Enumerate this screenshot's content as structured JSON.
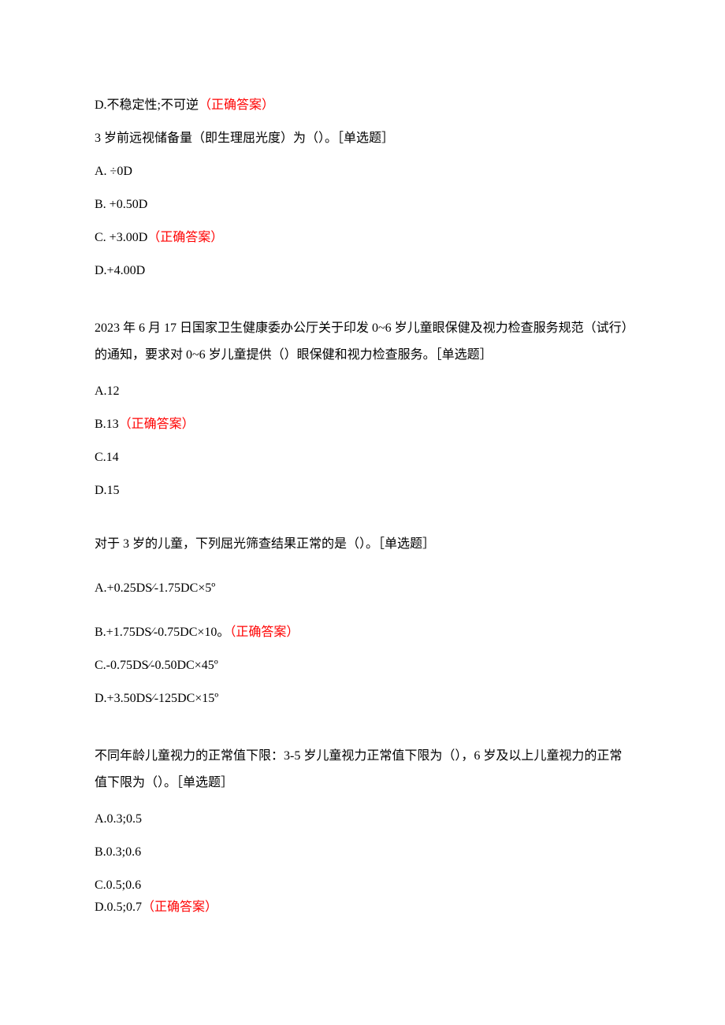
{
  "q0": {
    "optD_pre": "D.不稳定性;不可逆",
    "optD_ans": "（正确答案）"
  },
  "q1": {
    "stem": "3 岁前远视储备量（即生理屈光度）为（）。［单选题］",
    "A": "A.  ÷0D",
    "B": "B.  +0.50D",
    "C_pre": "C.  +3.00D",
    "C_ans": "（正确答案）",
    "D": "D.+4.00D"
  },
  "q2": {
    "stem": "2023 年 6 月 17 日国家卫生健康委办公厅关于印发 0~6 岁儿童眼保健及视力检查服务规范（试行）的通知，要求对 0~6 岁儿童提供（）眼保健和视力检查服务。［单选题］",
    "A": "A.12",
    "B_pre": "B.13",
    "B_ans": "（正确答案）",
    "C": "C.14",
    "D": "D.15"
  },
  "q3": {
    "stem": "对于 3 岁的儿童，下列屈光筛查结果正常的是（）。［单选题］",
    "A": "A.+0.25DS⁄-1.75DC×5º",
    "B_pre": "B.+1.75DS⁄-0.75DC×10。",
    "B_ans": "（正确答案）",
    "C": "C.-0.75DS⁄-0.50DC×45º",
    "D": "D.+3.50DS⁄-125DC×15º"
  },
  "q4": {
    "stem": "不同年龄儿童视力的正常值下限：3-5 岁儿童视力正常值下限为（），6 岁及以上儿童视力的正常值下限为（）。［单选题］",
    "A": "A.0.3;0.5",
    "B": "B.0.3;0.6",
    "C": "C.0.5;0.6",
    "D_pre": "D.0.5;0.7",
    "D_ans": "（正确答案）"
  }
}
